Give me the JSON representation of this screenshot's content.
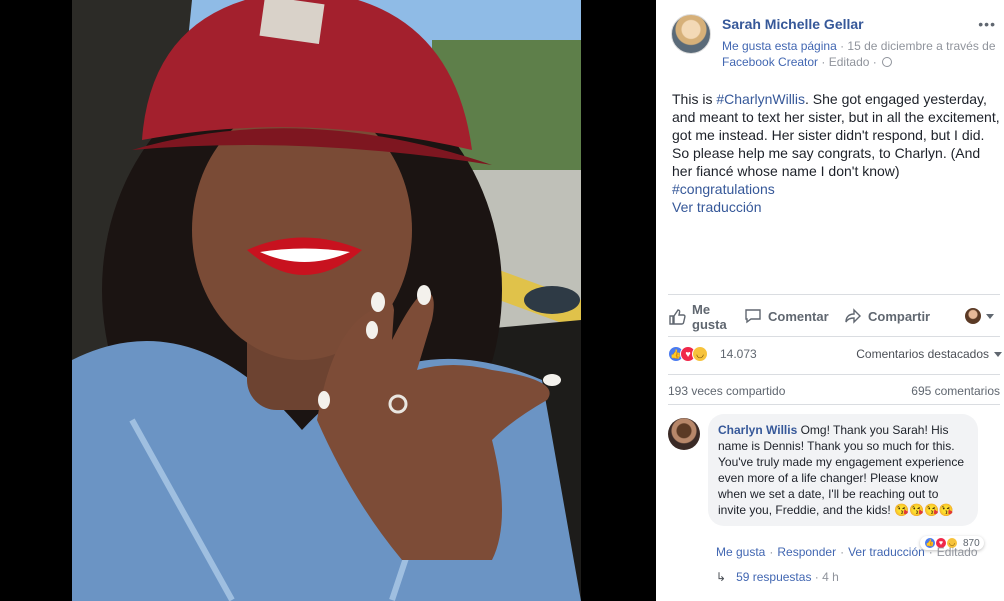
{
  "post": {
    "page_name": "Sarah Michelle Gellar",
    "more_icon": "more-icon",
    "meta_like": "Me gusta esta página",
    "meta_rest": "· 15 de diciembre a través de",
    "meta_app": "Facebook Creator",
    "meta_edited": "· Editado ·",
    "text_before_hashtag": "This is",
    "inline_hashtag": "#CharlynWillis",
    "text_after_hashtag": ". She got engaged yesterday, and meant to text her sister, but in all the excitement, got me instead. Her sister didn't respond, but I did. So please help me say congrats, to Charlyn. (And her fiancé whose name I don't know)",
    "hashtag": "#congratulations",
    "translate": "Ver traducción"
  },
  "actions": {
    "like": "Me gusta",
    "comment": "Comentar",
    "share": "Compartir"
  },
  "stats": {
    "reactions_count": "14.073",
    "sort_label": "Comentarios destacados",
    "shares": "193 veces compartido",
    "comments": "695 comentarios"
  },
  "comment": {
    "author": "Charlyn Willis",
    "text": "Omg! Thank you Sarah! His name is Dennis! Thank you so much for this. You've truly made my engagement experience even more of a life changer! Please know when we set a date, I'll be reaching out to invite you, Freddie, and the kids! 😘😘😘😘",
    "reaction_count": "870",
    "like": "Me gusta",
    "reply": "Responder",
    "translate": "Ver traducción",
    "edited": "Editado",
    "replies": "59 respuestas",
    "time": "· 4 h"
  },
  "colors": {
    "link": "#365899",
    "like_blue": "#4a7bf0",
    "love_red": "#f0284a",
    "haha_yellow": "#f7c33c"
  }
}
